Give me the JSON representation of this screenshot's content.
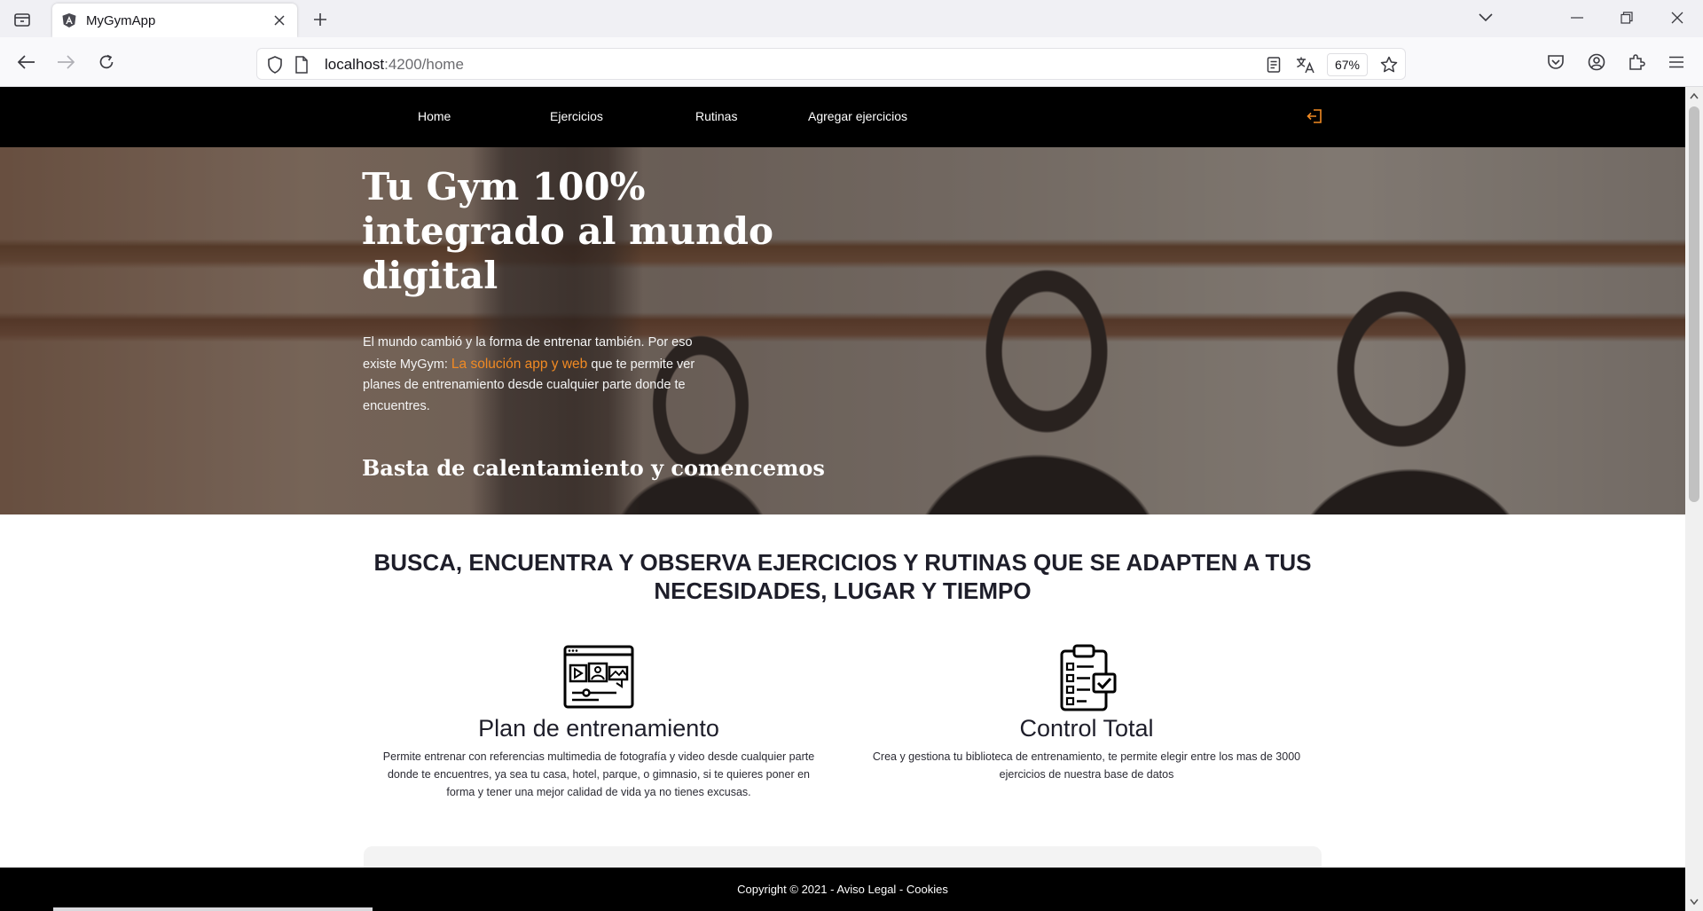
{
  "browser": {
    "tab_title": "MyGymApp",
    "url_host": "localhost",
    "url_path": ":4200/home",
    "zoom": "67%"
  },
  "site_nav": {
    "items": [
      {
        "label": "Home"
      },
      {
        "label": "Ejercicios"
      },
      {
        "label": "Rutinas"
      },
      {
        "label": "Agregar ejercicios"
      }
    ]
  },
  "hero": {
    "title": "Tu Gym 100% integrado al mundo digital",
    "text_before": "El mundo cambió y la forma de entrenar también. Por eso existe MyGym: ",
    "text_highlight": "La solución app y web",
    "text_after": " que te permite ver planes de entrenamiento desde cualquier parte donde te encuentres.",
    "subtitle": "Basta de calentamiento y comencemos"
  },
  "features": {
    "heading_before": "BUSCA, ENCUENTRA Y OBSERVA ",
    "heading_bold": "EJERCICIOS Y RUTINAS",
    "heading_after": " QUE SE ADAPTEN A TUS NECESIDADES, LUGAR Y TIEMPO",
    "items": [
      {
        "icon": "multimedia-window-icon",
        "title": "Plan de entrenamiento",
        "text": "Permite entrenar con referencias multimedia de fotografía y video desde cualquier parte donde te encuentres, ya sea tu casa, hotel, parque, o gimnasio, si te quieres poner en forma y tener una mejor calidad de vida ya no tienes excusas."
      },
      {
        "icon": "clipboard-checklist-icon",
        "title": "Control Total",
        "text": "Crea y gestiona tu biblioteca de entrenamiento, te permite elegir entre los mas de 3000 ejercicios de nuestra base de datos"
      }
    ]
  },
  "footer": {
    "text": "Copyright © 2021 - Aviso Legal - Cookies"
  },
  "colors": {
    "accent_orange": "#f18a23",
    "nav_bg": "#000000"
  }
}
